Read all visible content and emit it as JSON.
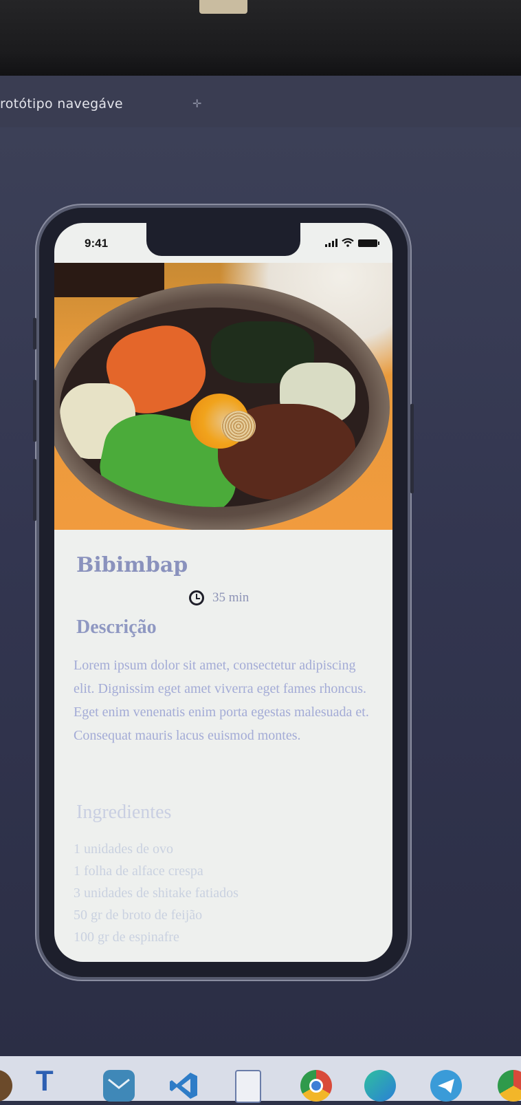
{
  "app": {
    "title": "rotótipo navegáve"
  },
  "status_bar": {
    "time": "9:41"
  },
  "recipe": {
    "title": "Bibimbap",
    "time": "35 min",
    "description_heading": "Descrição",
    "description": "Lorem ipsum dolor sit amet, consectetur adipiscing elit. Dignissim eget amet viverra eget fames rhoncus. Eget enim venenatis enim porta egestas malesuada et. Consequat mauris lacus euismod montes.",
    "ingredients_heading": "Ingredientes",
    "ingredients": [
      "1 unidades de ovo",
      "1 folha de alface crespa",
      "3 unidades de shitake fatiados",
      "50 gr de broto de feijão",
      "100 gr de espinafre"
    ]
  },
  "taskbar": {
    "letter_icon_text": "T",
    "icons": [
      "unknown-icon",
      "t-letter-icon",
      "mail-icon",
      "vscode-icon",
      "document-icon",
      "chrome-icon",
      "edge-icon",
      "telegram-icon",
      "chrome-icon"
    ]
  }
}
